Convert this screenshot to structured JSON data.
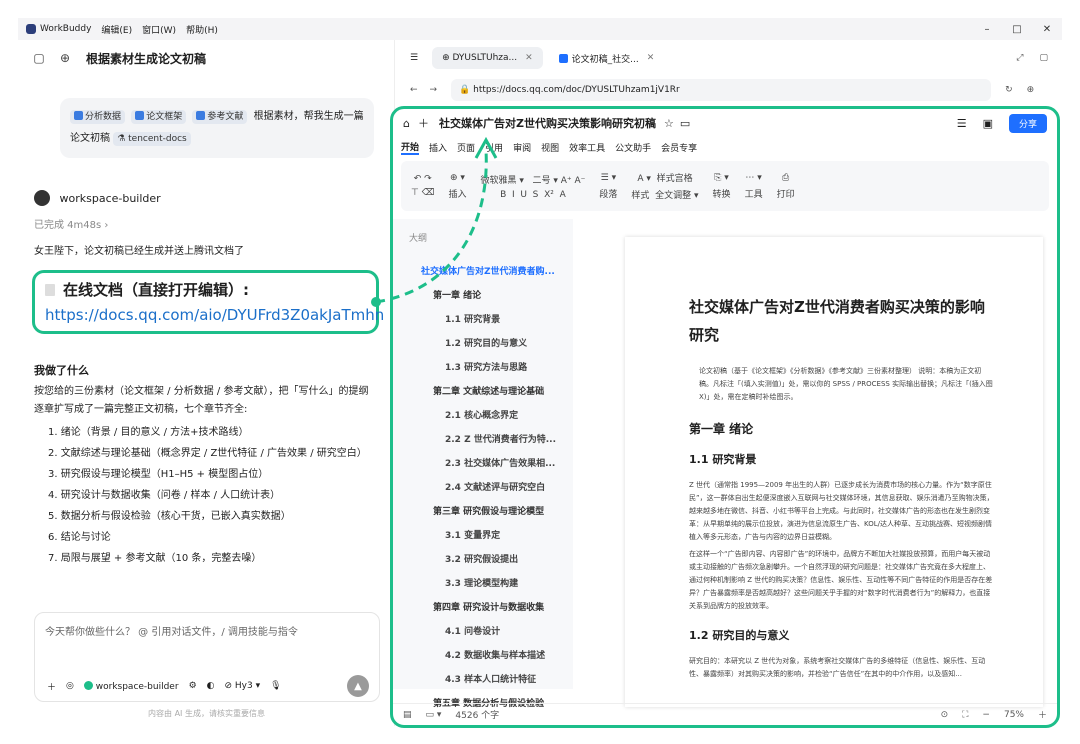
{
  "app": {
    "name": "WorkBuddy",
    "menus": [
      "编辑(E)",
      "窗口(W)",
      "帮助(H)"
    ]
  },
  "left": {
    "title": "根据素材生成论文初稿",
    "user_message": {
      "tags": [
        "分析数据",
        "论文框架",
        "参考文献"
      ],
      "text": "根据素材，帮我生成一篇论文初稿",
      "mention": "tencent-docs"
    },
    "agent_name": "workspace-builder",
    "status": "已完成 4m48s",
    "reply_line": "女王陛下，论文初稿已经生成并送上腾讯文档了",
    "online_doc_heading": "在线文档（直接打开编辑）:",
    "online_doc_url": "https://docs.qq.com/aio/DYUFrd3Z0akJaTmhn",
    "did_heading": "我做了什么",
    "did_desc": "按您给的三份素材（论文框架 / 分析数据 / 参考文献），把「写什么」的提纲逐章扩写成了一篇完整正文初稿，七个章节齐全:",
    "chapters": [
      "1. 绪论（背景 / 目的意义 / 方法+技术路线）",
      "2. 文献综述与理论基础（概念界定 / Z世代特征 / 广告效果 / 研究空白）",
      "3. 研究假设与理论模型（H1–H5 + 模型图占位）",
      "4. 研究设计与数据收集（问卷 / 样本 / 人口统计表）",
      "5. 数据分析与假设检验（核心干货，已嵌入真实数据）",
      "6. 结论与讨论",
      "7. 局限与展望 + 参考文献（10 条，完整去噪）"
    ],
    "input_placeholder": "今天帮你做些什么？ @ 引用对话文件，/ 调用技能与指令",
    "input_agent": "workspace-builder",
    "model": "Hy3",
    "disclaimer": "内容由 AI 生成，请核实重要信息"
  },
  "browser": {
    "tabs": [
      "DYUSLTUhza...",
      "论文初稿_社交..."
    ],
    "url": "https://docs.qq.com/doc/DYUSLTUhzam1jV1Rr"
  },
  "doc": {
    "title": "社交媒体广告对Z世代购买决策影响研究初稿",
    "share": "分享",
    "menu_tabs": [
      "开始",
      "插入",
      "页面",
      "引用",
      "审阅",
      "视图",
      "效率工具",
      "公文助手",
      "会员专享"
    ],
    "toolbar": {
      "font": "微软雅黑",
      "size": "二号",
      "paragraph": "段落",
      "style": "样式",
      "style_grid": "样式宫格",
      "full_text": "全文调整",
      "convert": "转换",
      "tools": "工具",
      "print": "打印",
      "insert": "插入"
    },
    "outline_label": "大纲",
    "outline": [
      {
        "level": 0,
        "text": "社交媒体广告对Z世代消费者购..."
      },
      {
        "level": 1,
        "text": "第一章 绪论"
      },
      {
        "level": 2,
        "text": "1.1 研究背景"
      },
      {
        "level": 2,
        "text": "1.2 研究目的与意义"
      },
      {
        "level": 2,
        "text": "1.3 研究方法与思路"
      },
      {
        "level": 1,
        "text": "第二章 文献综述与理论基础"
      },
      {
        "level": 2,
        "text": "2.1 核心概念界定"
      },
      {
        "level": 2,
        "text": "2.2 Z 世代消费者行为特..."
      },
      {
        "level": 2,
        "text": "2.3 社交媒体广告效果相..."
      },
      {
        "level": 2,
        "text": "2.4 文献述评与研究空白"
      },
      {
        "level": 1,
        "text": "第三章 研究假设与理论模型"
      },
      {
        "level": 2,
        "text": "3.1 变量界定"
      },
      {
        "level": 2,
        "text": "3.2 研究假设提出"
      },
      {
        "level": 2,
        "text": "3.3 理论模型构建"
      },
      {
        "level": 1,
        "text": "第四章 研究设计与数据收集"
      },
      {
        "level": 2,
        "text": "4.1 问卷设计"
      },
      {
        "level": 2,
        "text": "4.2 数据收集与样本描述"
      },
      {
        "level": 2,
        "text": "4.3 样本人口统计特征"
      },
      {
        "level": 1,
        "text": "第五章 数据分析与假设检验"
      }
    ],
    "page": {
      "h1": "社交媒体广告对Z世代消费者购买决策的影响研究",
      "note": "论文初稿（基于《论文框架》《分析数据》《参考文献》三份素材整理） 说明：本稿为正文初稿。凡标注「(填入实测值)」处，需以你的 SPSS / PROCESS 实际输出替换；凡标注「(插入图 X)」处，需在定稿时补绘图示。",
      "ch1": "第一章 绪论",
      "s11": "1.1 研究背景",
      "p1": "Z 世代（通常指 1995—2009 年出生的人群）已逐步成长为消费市场的核心力量。作为“数字原住民”，这一群体自出生起便深度嵌入互联网与社交媒体环境，其信息获取、娱乐消遣乃至购物决策，越来越多地在微信、抖音、小红书等平台上完成。与此同时，社交媒体广告的形态也在发生剧烈变革：从早期单纯的展示位投放，演进为信息流原生广告、KOL/达人种草、互动挑战赛、短视频剧情植入等多元形态，广告与内容的边界日益模糊。",
      "p2": "在这样一个“广告即内容、内容即广告”的环境中，品牌方不断加大社媒投放预算，而用户每天被动或主动接触的广告频次急剧攀升。一个自然浮现的研究问题是：社交媒体广告究竟在多大程度上、通过何种机制影响 Z 世代的购买决策？信息性、娱乐性、互动性等不同广告特征的作用是否存在差异？广告暴露频率是否越高越好？这些问题关乎手握的对“数字时代消费者行为”的解释力，也直接关系到品牌方的投放效率。",
      "s12": "1.2 研究目的与意义",
      "p3": "研究目的：本研究以 Z 世代为对象，系统考察社交媒体广告的多维特征（信息性、娱乐性、互动性、暴露频率）对其购买决策的影响，并检验“广告信任”在其中的中介作用，以及感知..."
    },
    "status": {
      "words": "4526 个字",
      "zoom": "75%"
    }
  }
}
